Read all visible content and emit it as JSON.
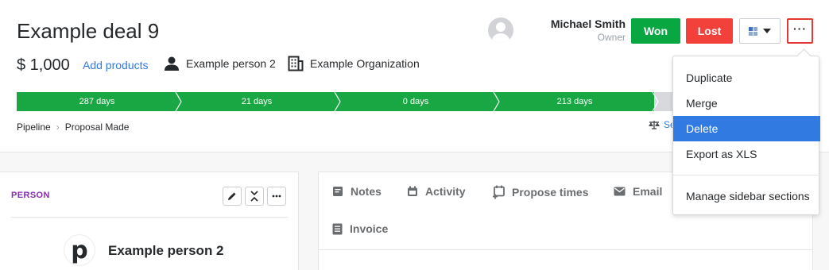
{
  "deal": {
    "title": "Example deal 9",
    "value": "$ 1,000",
    "add_products": "Add products",
    "person": "Example person 2",
    "organization": "Example Organization"
  },
  "owner": {
    "name": "Michael Smith",
    "role": "Owner"
  },
  "actions": {
    "won": "Won",
    "lost": "Lost",
    "more": "···"
  },
  "pipeline": {
    "stages": [
      "287 days",
      "21 days",
      "0 days",
      "213 days",
      ""
    ],
    "breadcrumb": [
      "Pipeline",
      "Proposal Made"
    ],
    "settings_link_partial": "Se"
  },
  "colors": {
    "won": "#08a742",
    "lost": "#f2403a",
    "accent": "#317ae2",
    "stage_active": "#19a744",
    "person_label": "#8a2bb5"
  },
  "person_card": {
    "label": "PERSON",
    "name": "Example person 2",
    "avatar_letter": "p"
  },
  "tabs": [
    "Notes",
    "Activity",
    "Propose times",
    "Email",
    "Invoice"
  ],
  "menu": {
    "items": [
      "Duplicate",
      "Merge",
      "Delete",
      "Export as XLS",
      "Manage sidebar sections"
    ],
    "active_index": 2
  }
}
